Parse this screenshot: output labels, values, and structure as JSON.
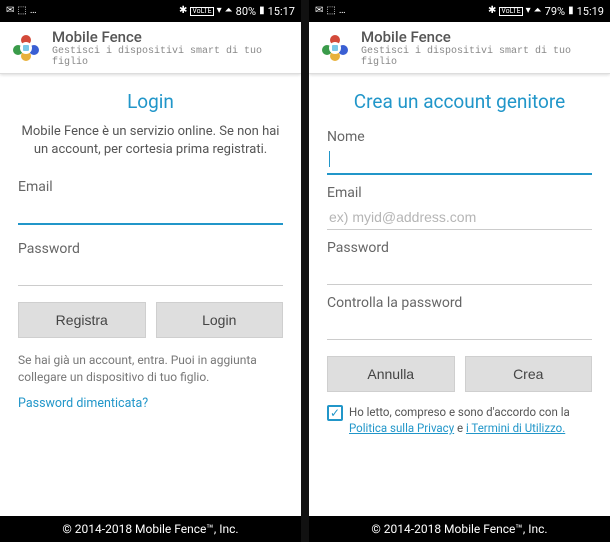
{
  "left": {
    "statusbar": {
      "battery": "80%",
      "time": "15:17"
    },
    "appbar": {
      "title": "Mobile Fence",
      "subtitle": "Gestisci i dispositivi smart di tuo figlio"
    },
    "page_title": "Login",
    "intro": "Mobile Fence è un servizio online. Se non hai un account, per cortesia prima registrati.",
    "email_label": "Email",
    "password_label": "Password",
    "btn_register": "Registra",
    "btn_login": "Login",
    "note": "Se hai già un account, entra. Puoi in aggiunta collegare un dispositivo di tuo figlio.",
    "forgot": "Password dimenticata?",
    "footer": "© 2014-2018 Mobile Fence™, Inc."
  },
  "right": {
    "statusbar": {
      "battery": "79%",
      "time": "15:19"
    },
    "appbar": {
      "title": "Mobile Fence",
      "subtitle": "Gestisci i dispositivi smart di tuo figlio"
    },
    "page_title": "Crea un account genitore",
    "name_label": "Nome",
    "email_label": "Email",
    "email_placeholder": "ex) myid@address.com",
    "password_label": "Password",
    "confirm_label": "Controlla la password",
    "btn_cancel": "Annulla",
    "btn_create": "Crea",
    "tos_prefix": "Ho letto, compreso e sono d'accordo con la ",
    "tos_privacy": "Politica sulla Privacy",
    "tos_mid": " e ",
    "tos_terms": "i Termini di Utilizzo.",
    "footer": "© 2014-2018 Mobile Fence™, Inc."
  }
}
